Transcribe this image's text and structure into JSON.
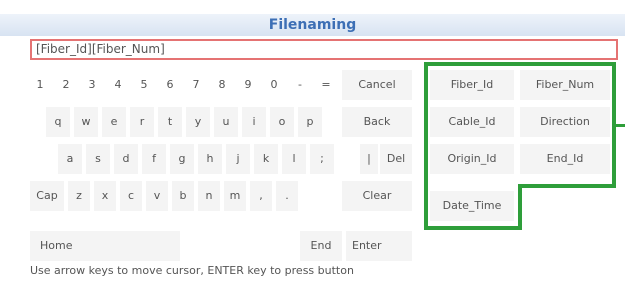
{
  "dialog": {
    "title": "Filenaming"
  },
  "entry": {
    "value": "[Fiber_Id][Fiber_Num]"
  },
  "rows": {
    "row1": [
      "1",
      "2",
      "3",
      "4",
      "5",
      "6",
      "7",
      "8",
      "9",
      "0",
      "-",
      "="
    ],
    "row2": [
      "q",
      "w",
      "e",
      "r",
      "t",
      "y",
      "u",
      "i",
      "o",
      "p"
    ],
    "row3": [
      "a",
      "s",
      "d",
      "f",
      "g",
      "h",
      "j",
      "k",
      "l",
      ";"
    ],
    "row4_cap": "Cap",
    "row4": [
      "z",
      "x",
      "c",
      "v",
      "b",
      "n",
      "m",
      ",",
      "."
    ]
  },
  "controls": {
    "cancel": "Cancel",
    "back": "Back",
    "pipe": "|",
    "del": "Del",
    "clear": "Clear",
    "home": "Home",
    "end": "End",
    "enter": "Enter"
  },
  "macros": {
    "fiber_id": "Fiber_Id",
    "fiber_num": "Fiber_Num",
    "cable_id": "Cable_Id",
    "direction": "Direction",
    "origin_id": "Origin_Id",
    "end_id": "End_Id",
    "date_time": "Date_Time"
  },
  "hint": "Use arrow keys to move cursor, ENTER key to press button",
  "colors": {
    "highlight": "#2e9e3a",
    "title": "#3d6fb5",
    "entry_border": "#e57373"
  }
}
